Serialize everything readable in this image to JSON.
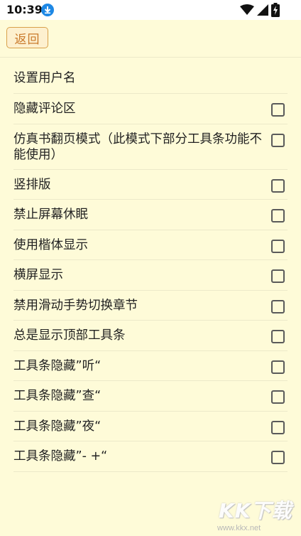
{
  "status_bar": {
    "time": "10:39"
  },
  "toolbar": {
    "back_label": "返回"
  },
  "settings": [
    {
      "label": "设置用户名",
      "has_checkbox": false,
      "checked": false
    },
    {
      "label": "隐藏评论区",
      "has_checkbox": true,
      "checked": false
    },
    {
      "label": "仿真书翻页模式（此模式下部分工具条功能不能使用）",
      "has_checkbox": true,
      "checked": false
    },
    {
      "label": "竖排版",
      "has_checkbox": true,
      "checked": false
    },
    {
      "label": "禁止屏幕休眠",
      "has_checkbox": true,
      "checked": false
    },
    {
      "label": "使用楷体显示",
      "has_checkbox": true,
      "checked": false
    },
    {
      "label": "横屏显示",
      "has_checkbox": true,
      "checked": false
    },
    {
      "label": "禁用滑动手势切换章节",
      "has_checkbox": true,
      "checked": false
    },
    {
      "label": "总是显示顶部工具条",
      "has_checkbox": true,
      "checked": false
    },
    {
      "label": "工具条隐藏”听“",
      "has_checkbox": true,
      "checked": false
    },
    {
      "label": "工具条隐藏”查“",
      "has_checkbox": true,
      "checked": false
    },
    {
      "label": "工具条隐藏”夜“",
      "has_checkbox": true,
      "checked": false
    },
    {
      "label": "工具条隐藏”- +“",
      "has_checkbox": true,
      "checked": false
    }
  ],
  "watermark": {
    "logo": "KK下载",
    "url": "www.kkx.net"
  },
  "colors": {
    "background": "#fefbd8",
    "accent": "#c9792a"
  }
}
